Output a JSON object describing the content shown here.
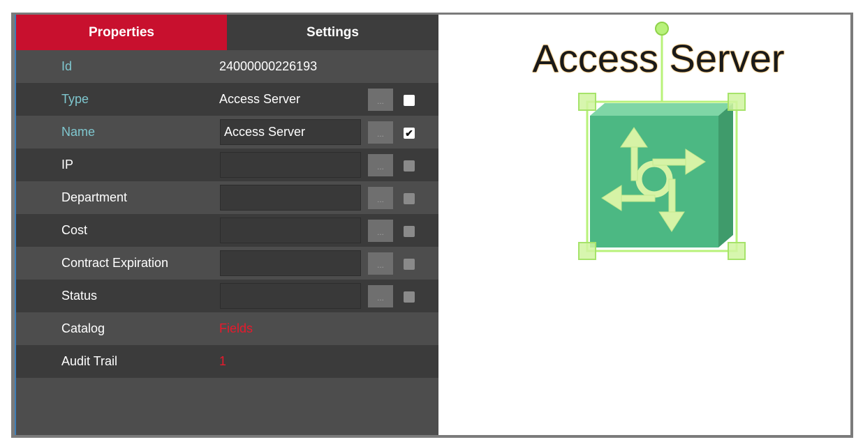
{
  "tabs": {
    "properties": "Properties",
    "settings": "Settings"
  },
  "fields": [
    {
      "label": "Id",
      "value": "24000000226193"
    },
    {
      "label": "Type",
      "value": "Access Server"
    },
    {
      "label": "Name",
      "value": "Access Server"
    },
    {
      "label": "IP",
      "value": ""
    },
    {
      "label": "Department",
      "value": ""
    },
    {
      "label": "Cost",
      "value": ""
    },
    {
      "label": "Contract Expiration",
      "value": ""
    },
    {
      "label": "Status",
      "value": ""
    },
    {
      "label": "Catalog",
      "value": "Fields"
    },
    {
      "label": "Audit Trail",
      "value": "1"
    }
  ],
  "ellipsis_label": "...",
  "checkmark": "✔",
  "canvas": {
    "shape_label": "Access Server",
    "shape_icon": "access-server-icon"
  },
  "colors": {
    "tab_active": "#c8102e",
    "accent_label": "#7fc7cf",
    "link": "#e8192c",
    "shape_fill": "#4cb883",
    "selection": "#b8f27a"
  }
}
